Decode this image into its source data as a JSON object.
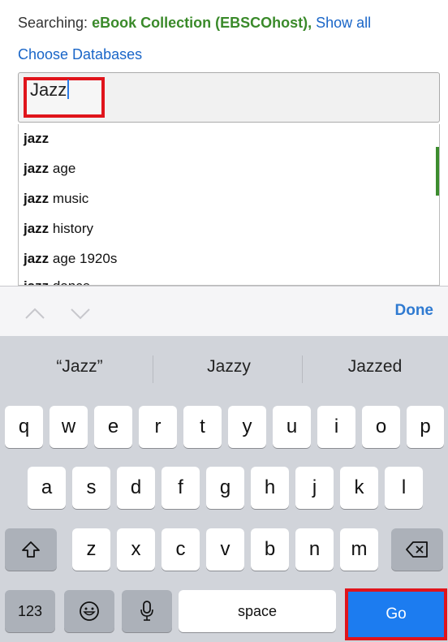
{
  "header": {
    "searching_label": "Searching:",
    "database_name": "eBook Collection (EBSCOhost),",
    "show_all": "Show all",
    "choose_databases": "Choose Databases"
  },
  "search": {
    "value": "Jazz"
  },
  "suggestions": [
    {
      "bold": "jazz",
      "rest": ""
    },
    {
      "bold": "jazz",
      "rest": " age"
    },
    {
      "bold": "jazz",
      "rest": " music"
    },
    {
      "bold": "jazz",
      "rest": " history"
    },
    {
      "bold": "jazz",
      "rest": " age 1920s"
    },
    {
      "bold": "jazz",
      "rest": " dance"
    }
  ],
  "accessory": {
    "done_label": "Done",
    "prev_icon": "chevron-up-icon",
    "next_icon": "chevron-down-icon"
  },
  "predictions": [
    "“Jazz”",
    "Jazzy",
    "Jazzed"
  ],
  "keyboard": {
    "row1": [
      "q",
      "w",
      "e",
      "r",
      "t",
      "y",
      "u",
      "i",
      "o",
      "p"
    ],
    "row2": [
      "a",
      "s",
      "d",
      "f",
      "g",
      "h",
      "j",
      "k",
      "l"
    ],
    "row3": [
      "z",
      "x",
      "c",
      "v",
      "b",
      "n",
      "m"
    ],
    "numbers_label": "123",
    "space_label": "space",
    "go_label": "Go",
    "shift_icon": "shift-icon",
    "delete_icon": "backspace-icon",
    "emoji_icon": "emoji-icon",
    "mic_icon": "microphone-icon"
  },
  "colors": {
    "database_green": "#3a8a2a",
    "link_blue": "#1a66c8",
    "highlight_red": "#e0141b",
    "go_blue": "#1c7cf0"
  }
}
